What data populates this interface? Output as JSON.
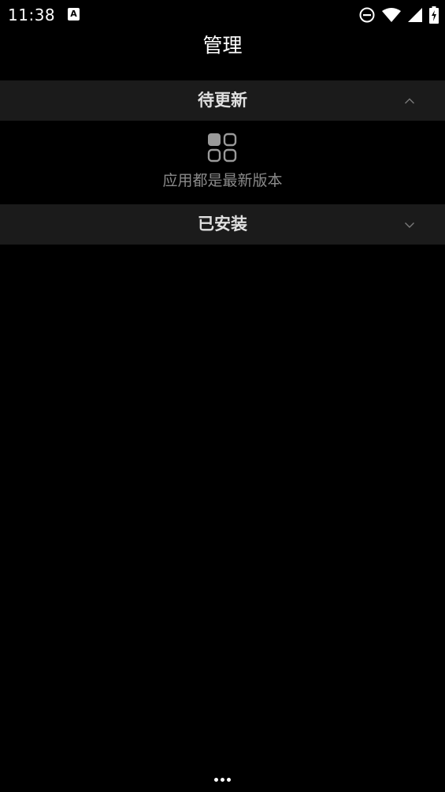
{
  "status_bar": {
    "time": "11:38",
    "notification_icon": "a-letter-icon",
    "icons": [
      "do-not-disturb-icon",
      "wifi-icon",
      "cell-signal-icon",
      "battery-charging-icon"
    ]
  },
  "header": {
    "title": "管理"
  },
  "sections": {
    "updates": {
      "label": "待更新",
      "expanded": true,
      "chevron": "chevron-up-icon"
    },
    "installed": {
      "label": "已安装",
      "expanded": false,
      "chevron": "chevron-down-icon"
    }
  },
  "empty_state": {
    "icon": "apps-grid-icon",
    "message": "应用都是最新版本"
  },
  "nav_bar": {
    "icon": "more-dots-icon"
  },
  "colors": {
    "background": "#000000",
    "section_header_bg": "#1b1b1b",
    "section_label": "#e0e0e0",
    "muted_text": "#8a8a8a",
    "icon_gray": "#9a9a9a"
  }
}
